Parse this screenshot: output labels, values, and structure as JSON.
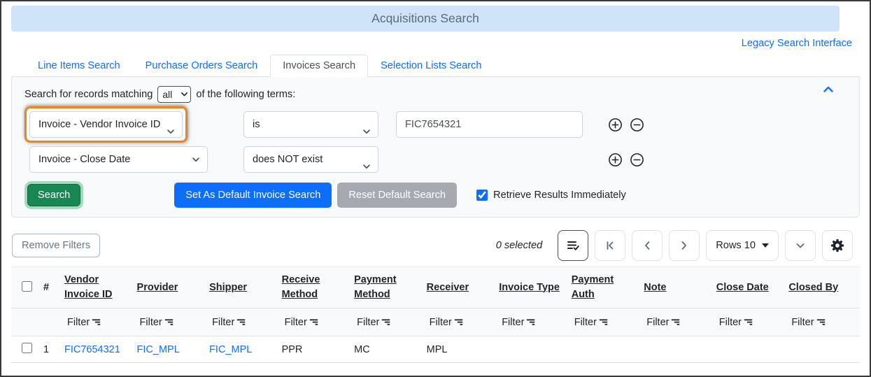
{
  "header": {
    "title": "Acquisitions Search",
    "legacy_link_label": "Legacy Search Interface"
  },
  "tabs": [
    {
      "label": "Line Items Search",
      "active": false
    },
    {
      "label": "Purchase Orders Search",
      "active": false
    },
    {
      "label": "Invoices Search",
      "active": true
    },
    {
      "label": "Selection Lists Search",
      "active": false
    }
  ],
  "search_form": {
    "match_text_before": "Search for records matching",
    "match_selected_option": "all",
    "match_text_after": "of the following terms:",
    "terms": [
      {
        "field": "Invoice - Vendor Invoice ID",
        "operator": "is",
        "value": "FIC7654321",
        "highlighted": true
      },
      {
        "field": "Invoice - Close Date",
        "operator": "does NOT exist",
        "value": "",
        "highlighted": false
      }
    ],
    "search_button_label": "Search",
    "set_default_button_label": "Set As Default Invoice Search",
    "reset_default_button_label": "Reset Default Search",
    "retrieve_immediately_label": "Retrieve Results Immediately",
    "retrieve_immediately_checked": true
  },
  "grid": {
    "remove_filters_label": "Remove Filters",
    "selected_count_text": "0 selected",
    "rows_per_page_label": "Rows 10",
    "filter_label": "Filter",
    "row_number_header": "#",
    "columns": [
      "Vendor Invoice ID",
      "Provider",
      "Shipper",
      "Receive Method",
      "Payment Method",
      "Receiver",
      "Invoice Type",
      "Payment Auth",
      "Note",
      "Close Date",
      "Closed By"
    ],
    "rows": [
      {
        "row_number": "1",
        "vendor_invoice_id": "FIC7654321",
        "provider": "FIC_MPL",
        "shipper": "FIC_MPL",
        "receive_method": "PPR",
        "payment_method": "MC",
        "receiver": "MPL",
        "invoice_type": "",
        "payment_auth": "",
        "note": "",
        "close_date": "",
        "closed_by": ""
      }
    ]
  },
  "colors": {
    "accent_blue": "#0d6efd",
    "success_green": "#198754",
    "callout_orange": "#e8871e",
    "header_bg": "#cfe4f8",
    "panel_bg": "#f8f9fa",
    "muted_gray": "#6c757d"
  }
}
